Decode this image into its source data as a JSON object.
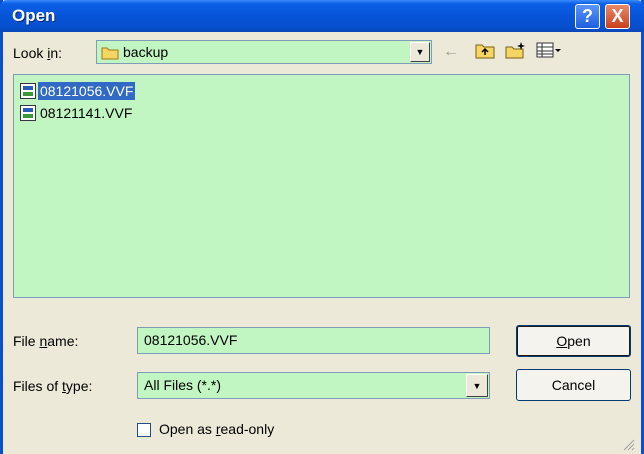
{
  "window": {
    "title": "Open",
    "help_glyph": "?",
    "close_glyph": "X"
  },
  "look_in": {
    "label_pre": "Look ",
    "label_access": "i",
    "label_post": "n:",
    "value": "backup",
    "icon": "folder-icon"
  },
  "toolbar": {
    "back_icon": "←",
    "up_icon": "⮤",
    "new_folder_icon": "✚",
    "views_icon": "▦▾"
  },
  "files": [
    {
      "name": "08121056.VVF",
      "selected": true
    },
    {
      "name": "08121141.VVF",
      "selected": false
    }
  ],
  "file_name": {
    "label_pre": "File ",
    "label_access": "n",
    "label_post": "ame:",
    "value": "08121056.VVF"
  },
  "file_type": {
    "label_pre": "Files of ",
    "label_access": "t",
    "label_post": "ype:",
    "value": "All Files (*.*)"
  },
  "buttons": {
    "open_access": "O",
    "open_rest": "pen",
    "cancel": "Cancel"
  },
  "read_only": {
    "label_pre": "Open as ",
    "label_access": "r",
    "label_post": "ead-only",
    "checked": false
  },
  "colors": {
    "field_bg": "#c1f5c1",
    "titlebar": "#0754d8",
    "selection": "#316ac5"
  }
}
